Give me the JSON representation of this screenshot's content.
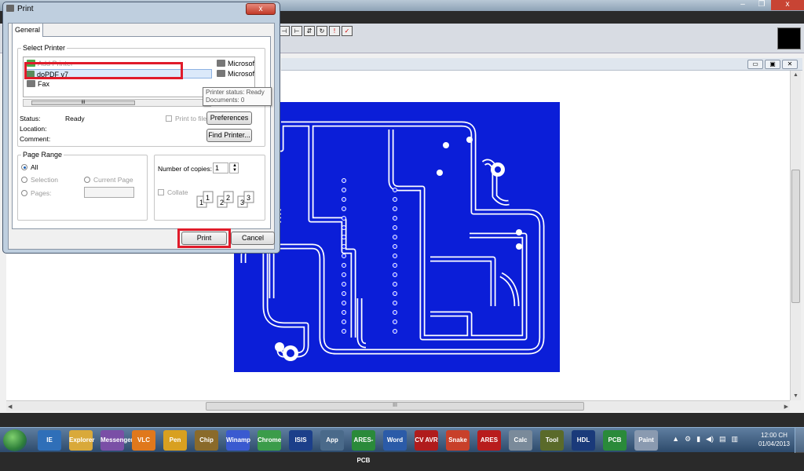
{
  "dialog": {
    "title": "Print",
    "close_label": "x",
    "tab": "General",
    "select_printer_label": "Select Printer",
    "printers": [
      {
        "name": "Add Printer",
        "icon": "add-printer-icon"
      },
      {
        "name": "doPDF v7",
        "icon": "dopdf-printer-icon",
        "selected": true
      },
      {
        "name": "Fax",
        "icon": "fax-icon"
      },
      {
        "name": "Microsoft X",
        "icon": "printer-icon"
      },
      {
        "name": "Microsoft X",
        "icon": "printer-icon"
      }
    ],
    "scroll_grip": "III",
    "tooltip": {
      "line1": "Printer status: Ready",
      "line2": "Documents: 0"
    },
    "status_label": "Status:",
    "status_value": "Ready",
    "location_label": "Location:",
    "comment_label": "Comment:",
    "print_to_file": "Print to file",
    "preferences": "Preferences",
    "find_printer": "Find Printer...",
    "page_range": {
      "label": "Page Range",
      "all": "All",
      "selection": "Selection",
      "current_page": "Current Page",
      "pages": "Pages:"
    },
    "copies_label": "Number of copies:",
    "copies_value": "1",
    "collate": "Collate",
    "collate_pages": [
      "1",
      "1",
      "2",
      "2",
      "3",
      "3"
    ],
    "print_button": "Print",
    "cancel_button": "Cancel"
  },
  "main_window": {
    "minimize": "–",
    "restore": "❐",
    "close": "x",
    "toolbar_icons": [
      "align-icon",
      "mirror-icon",
      "flip-icon",
      "rotate-icon",
      "drc-icon",
      "abc-icon"
    ],
    "scroll_grip": "III"
  },
  "pcb": {
    "board_color": "#0b1ed8",
    "trace_color": "#ffffff"
  },
  "taskbar": {
    "apps": [
      "IE",
      "Explorer",
      "Messenger",
      "VLC",
      "Pen",
      "Chip",
      "Winamp",
      "Chrome",
      "ISIS",
      "App",
      "ARES-PCB",
      "Word",
      "CV AVR",
      "Snake",
      "ARES",
      "Calc",
      "Tool",
      "HDL",
      "PCB",
      "Paint"
    ],
    "clock_time": "12:00 CH",
    "clock_date": "01/04/2013",
    "tray_icons": [
      "▲",
      "⚙",
      "▮",
      "◀)",
      "▤",
      "▥"
    ]
  },
  "colors": {
    "highlight": "#e01b2a",
    "selection": "#dbe9fa"
  }
}
